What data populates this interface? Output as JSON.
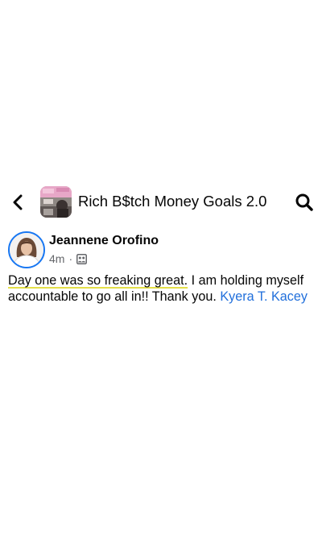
{
  "header": {
    "back_icon": "chevron-left-icon",
    "group_name": "Rich B$tch Money Goals 2.0",
    "search_icon": "search-icon"
  },
  "post": {
    "author": "Jeannene Orofino",
    "time": "4m",
    "separator": "·",
    "audience_icon": "group-audience-icon",
    "body_highlighted": "Day one was so freaking great.",
    "body_text": " I am holding myself accountable to go all in!! Thank you. ",
    "mention": "Kyera T. Kacey"
  },
  "colors": {
    "mention": "#216fdb",
    "avatar_ring": "#1877f2",
    "highlight_underline": "#e4e04a",
    "meta_text": "#65676b"
  }
}
